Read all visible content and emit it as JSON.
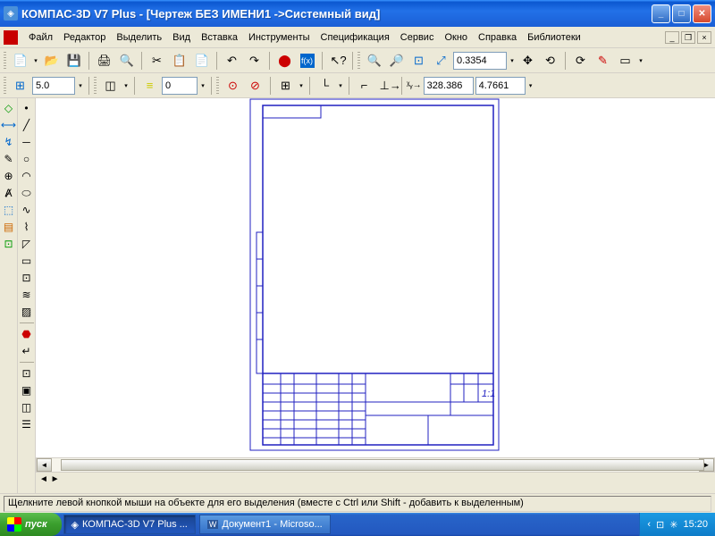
{
  "title": "КОМПАС-3D V7 Plus - [Чертеж БЕЗ ИМЕНИ1 ->Системный вид]",
  "menu": [
    "Файл",
    "Редактор",
    "Выделить",
    "Вид",
    "Вставка",
    "Инструменты",
    "Спецификация",
    "Сервис",
    "Окно",
    "Справка",
    "Библиотеки"
  ],
  "toolbar2": {
    "zoom": "0.3354"
  },
  "toolbar3": {
    "step": "5.0",
    "layer": "0",
    "x": "328.386",
    "y": "4.7661"
  },
  "status": "Щелкните левой кнопкой мыши на объекте для его выделения (вместе с Ctrl или Shift - добавить к выделенным)",
  "taskbar": {
    "start": "пуск",
    "task1": "КОМПАС-3D V7 Plus ...",
    "task2": "Документ1 - Microso...",
    "time": "15:20"
  }
}
